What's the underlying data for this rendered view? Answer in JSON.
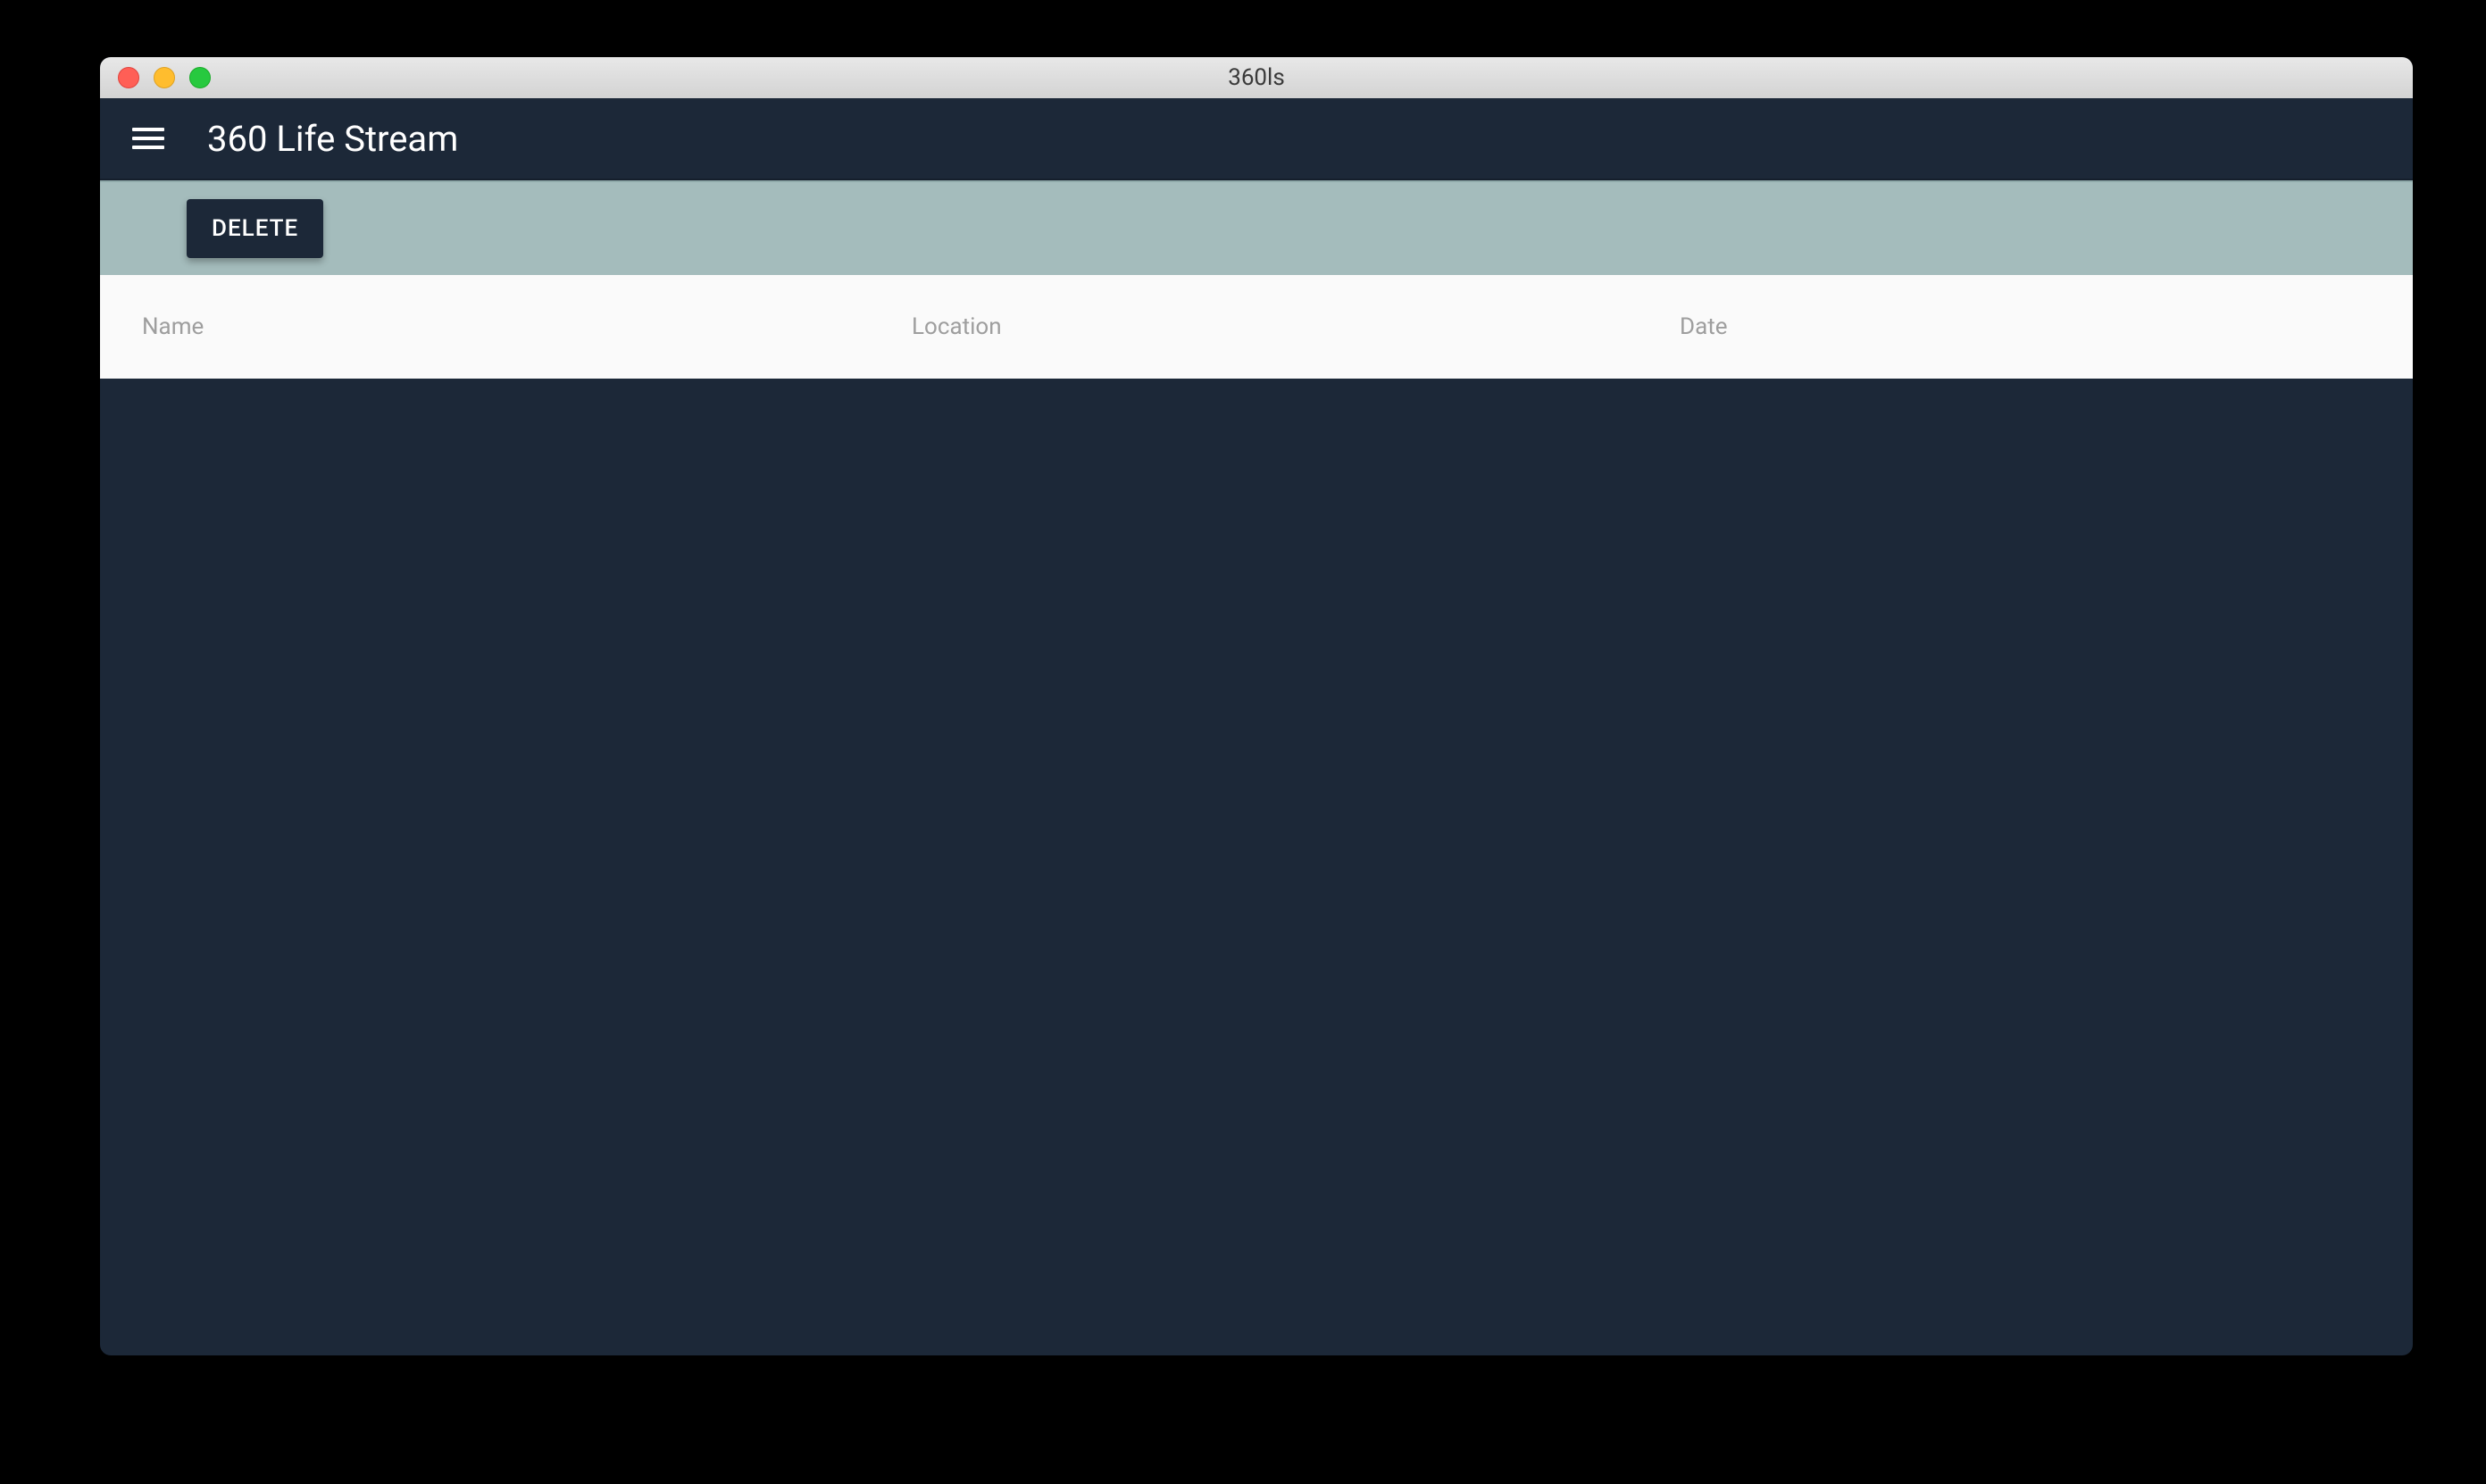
{
  "window": {
    "title": "360ls"
  },
  "appBar": {
    "title": "360 Life Stream"
  },
  "toolbar": {
    "delete_label": "DELETE"
  },
  "table": {
    "columns": {
      "name": "Name",
      "location": "Location",
      "date": "Date"
    },
    "rows": []
  }
}
